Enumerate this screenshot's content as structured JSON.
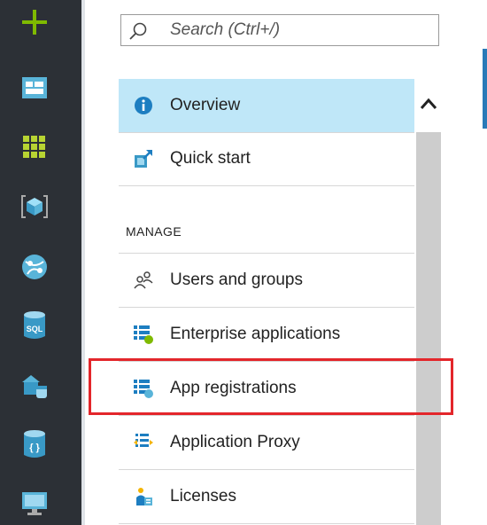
{
  "colors": {
    "left_bar": "#2c3036",
    "active_item": "#bfe7f8",
    "highlight_border": "#e3262b",
    "scrollbar": "#cdcdcd",
    "accent": "#2a7ab8"
  },
  "left_nav": [
    {
      "icon": "plus-icon",
      "label": "New"
    },
    {
      "icon": "dashboard-icon",
      "label": "Dashboard"
    },
    {
      "icon": "all-resources-icon",
      "label": "All resources"
    },
    {
      "icon": "resource-groups-icon",
      "label": "Resource groups"
    },
    {
      "icon": "app-services-icon",
      "label": "App Services"
    },
    {
      "icon": "sql-databases-icon",
      "label": "SQL databases"
    },
    {
      "icon": "sql-data-warehouses-icon",
      "label": "SQL data warehouses"
    },
    {
      "icon": "cosmos-db-icon",
      "label": "Azure Cosmos DB"
    },
    {
      "icon": "virtual-machines-icon",
      "label": "Virtual machines"
    }
  ],
  "search": {
    "placeholder": "Search (Ctrl+/)",
    "value": ""
  },
  "menu": {
    "overview": {
      "label": "Overview",
      "icon": "info-icon"
    },
    "quick_start": {
      "label": "Quick start",
      "icon": "quick-start-icon"
    },
    "section_manage": "MANAGE",
    "users_and_groups": {
      "label": "Users and groups",
      "icon": "users-icon"
    },
    "enterprise_applications": {
      "label": "Enterprise applications",
      "icon": "enterprise-apps-icon"
    },
    "app_registrations": {
      "label": "App registrations",
      "icon": "app-registrations-icon"
    },
    "application_proxy": {
      "label": "Application Proxy",
      "icon": "application-proxy-icon"
    },
    "licenses": {
      "label": "Licenses",
      "icon": "licenses-icon"
    }
  },
  "highlighted_item": "App registrations"
}
